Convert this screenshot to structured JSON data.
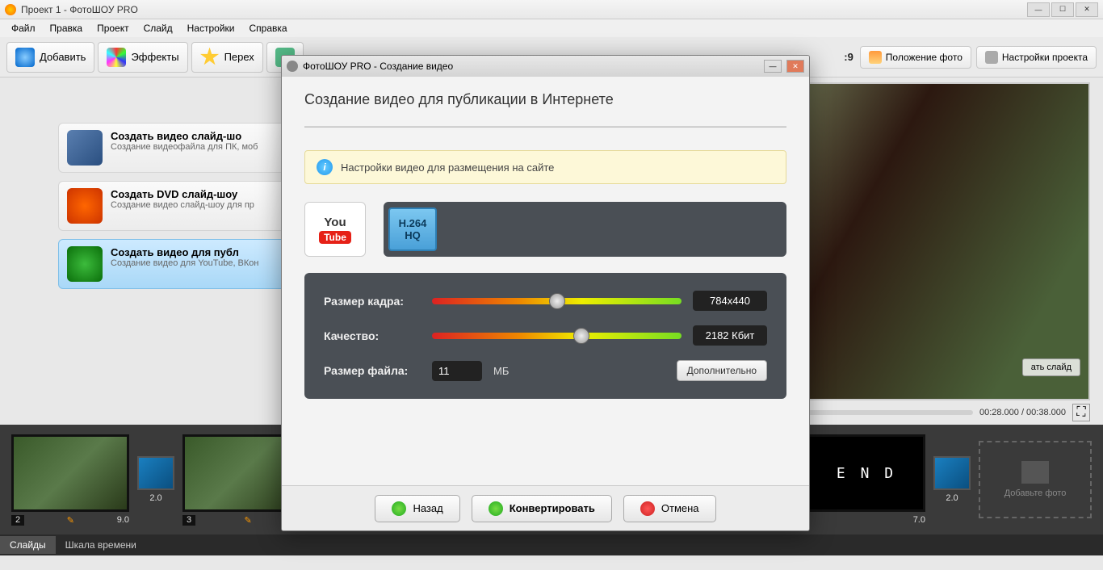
{
  "app": {
    "title": "Проект 1 - ФотоШОУ PRO"
  },
  "menu": {
    "file": "Файл",
    "edit": "Правка",
    "project": "Проект",
    "slide": "Слайд",
    "settings": "Настройки",
    "help": "Справка"
  },
  "toolbar": {
    "add": "Добавить",
    "effects": "Эффекты",
    "transitions": "Перех",
    "aspect_suffix": ":9",
    "position": "Положение фото",
    "proj_settings": "Настройки проекта"
  },
  "options": {
    "video": {
      "title": "Создать видео слайд-шо",
      "sub": "Создание видеофайла для ПК, моб"
    },
    "dvd": {
      "title": "Создать DVD слайд-шоу",
      "sub": "Создание видео слайд-шоу для пр"
    },
    "web": {
      "title": "Создать видео для публ",
      "sub": "Создание видео для YouTube, ВКон"
    }
  },
  "preview": {
    "edit_slide": "ать слайд",
    "time": "00:28.000 / 00:38.000"
  },
  "timeline": {
    "slides": [
      {
        "n": "2",
        "dur": "9.0",
        "trans": "2.0"
      },
      {
        "n": "3",
        "dur": "",
        "trans": ""
      },
      {
        "n": "end",
        "label": "E N D",
        "dur": "7.0",
        "trans": "2.0"
      }
    ],
    "add_photo": "Добавьте фото",
    "tab_slides": "Слайды",
    "tab_timeline": "Шкала времени"
  },
  "dialog": {
    "title": "ФотоШОУ PRO - Создание видео",
    "heading": "Создание видео для публикации в Интернете",
    "banner": "Настройки видео для размещения на сайте",
    "youtube_top": "You",
    "youtube_bot": "Tube",
    "codec_line1": "H.264",
    "codec_line2": "HQ",
    "frame_label": "Размер кадра:",
    "frame_value": "784x440",
    "quality_label": "Качество:",
    "quality_value": "2182 Кбит",
    "filesize_label": "Размер файла:",
    "filesize_value": "11",
    "filesize_unit": "МБ",
    "advanced": "Дополнительно",
    "back": "Назад",
    "convert": "Конвертировать",
    "cancel": "Отмена"
  }
}
